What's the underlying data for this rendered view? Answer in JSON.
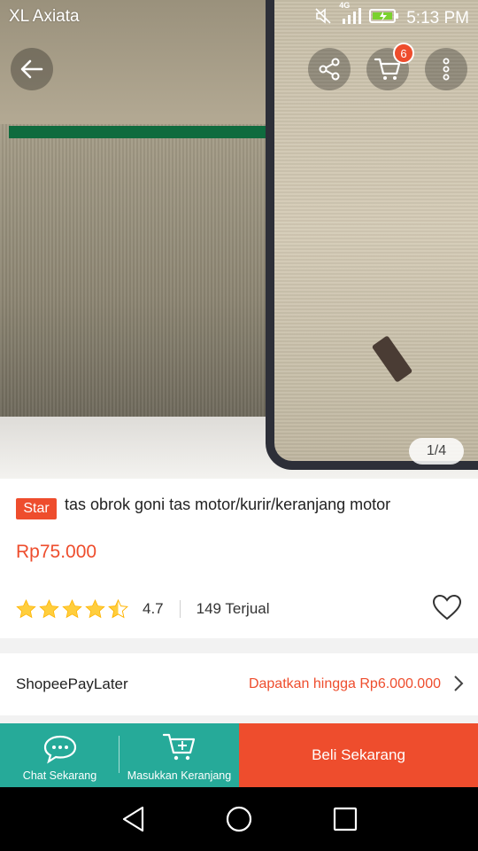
{
  "status_bar": {
    "carrier": "XL Axiata",
    "network": "4G",
    "time": "5:13 PM"
  },
  "top_actions": {
    "cart_badge_count": "6"
  },
  "gallery": {
    "counter": "1/4"
  },
  "product": {
    "badge": "Star",
    "title": "tas obrok goni tas motor/kurir/keranjang motor",
    "price": "Rp75.000",
    "rating": "4.7",
    "rating_stars": 4.5,
    "sold": "149 Terjual"
  },
  "paylater": {
    "label": "ShopeePayLater",
    "value": "Dapatkan hingga Rp6.000.000"
  },
  "action_bar": {
    "chat_label": "Chat Sekarang",
    "cart_label": "Masukkan Keranjang",
    "buy_label": "Beli Sekarang"
  },
  "colors": {
    "accent": "#ee4d2d",
    "teal": "#26aa99",
    "star": "#ffce3d"
  }
}
